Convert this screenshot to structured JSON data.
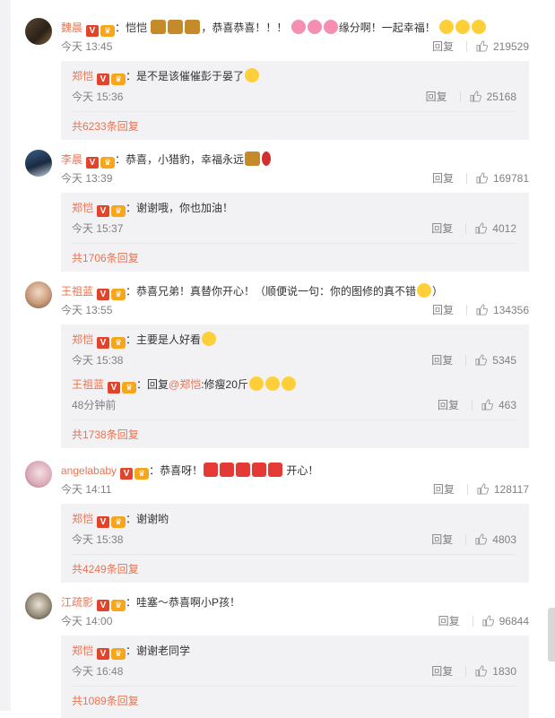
{
  "comments": [
    {
      "name": "魏晨",
      "text_a": "：恺恺",
      "text_b": "，恭喜恭喜！！！",
      "text_c": "缘分啊！一起幸福！",
      "time": "今天 13:45",
      "reply_label": "回复",
      "likes": "219529",
      "reply": {
        "name": "郑恺",
        "text": "：是不是该催催彭于晏了",
        "time": "今天 15:36",
        "reply_label": "回复",
        "likes": "25168"
      },
      "more": "共6233条回复"
    },
    {
      "name": "李晨",
      "text_a": "：恭喜，小猎豹，幸福永远",
      "time": "今天 13:39",
      "reply_label": "回复",
      "likes": "169781",
      "reply": {
        "name": "郑恺",
        "text": "：谢谢哦，你也加油！",
        "time": "今天 15:37",
        "reply_label": "回复",
        "likes": "4012"
      },
      "more": "共1706条回复"
    },
    {
      "name": "王祖蓝",
      "text_a": "：恭喜兄弟！真替你开心！（顺便说一句：你的图修的真不错",
      "text_b": "）",
      "time": "今天 13:55",
      "reply_label": "回复",
      "likes": "134356",
      "reply": {
        "name": "郑恺",
        "text": "：主要是人好看",
        "time": "今天 15:38",
        "reply_label": "回复",
        "likes": "5345"
      },
      "reply2": {
        "name": "王祖蓝",
        "prefix": "：回复",
        "mention": "@郑恺",
        "text": ":修瘦20斤",
        "time": "48分钟前",
        "reply_label": "回复",
        "likes": "463"
      },
      "more": "共1738条回复"
    },
    {
      "name": "angelababy",
      "text_a": "：恭喜呀！",
      "text_b": " 开心！",
      "time": "今天 14:11",
      "reply_label": "回复",
      "likes": "128117",
      "reply": {
        "name": "郑恺",
        "text": "：谢谢哟",
        "time": "今天 15:38",
        "reply_label": "回复",
        "likes": "4803"
      },
      "more": "共4249条回复"
    },
    {
      "name": "江疏影",
      "text_a": "：哇塞～恭喜啊小P孩！",
      "time": "今天 14:00",
      "reply_label": "回复",
      "likes": "96844",
      "reply": {
        "name": "郑恺",
        "text": "：谢谢老同学",
        "time": "今天 16:48",
        "reply_label": "回复",
        "likes": "1830"
      },
      "more": "共1089条回复"
    }
  ],
  "badges": {
    "v": "V",
    "crown": "♛"
  },
  "colors": {
    "accent": "#eb7350",
    "reply_bg": "#f2f2f5",
    "meta": "#808080",
    "v_badge": "#e2432b"
  }
}
